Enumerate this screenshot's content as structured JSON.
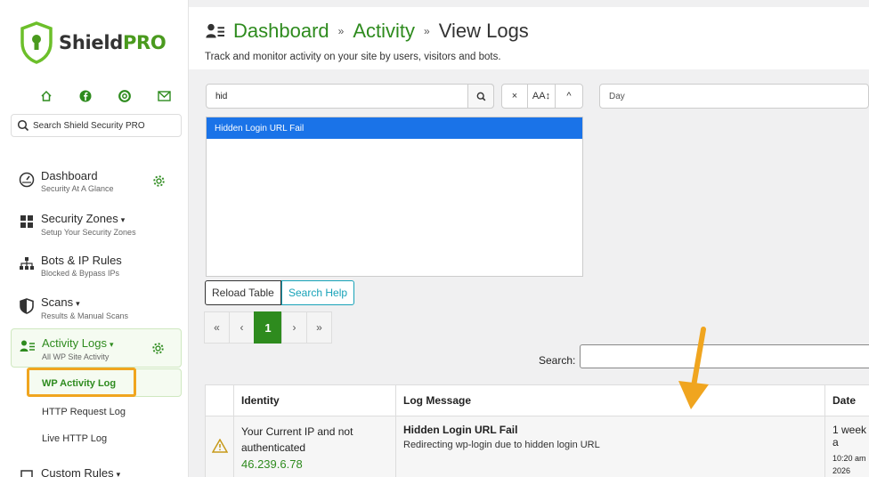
{
  "brand": {
    "name_main": "Shield",
    "name_accent": "PRO",
    "accent_color": "#2e8b1e",
    "highlight_color": "#f0a51f"
  },
  "sidebar": {
    "quick_icons": [
      "home-icon",
      "facebook-icon",
      "lifebuoy-icon",
      "mail-icon"
    ],
    "search_placeholder": "Search Shield Security PRO",
    "items": [
      {
        "title": "Dashboard",
        "sub": "Security At A Glance",
        "icon": "gauge-icon"
      },
      {
        "title": "Security Zones",
        "sub": "Setup Your Security Zones",
        "icon": "grid-icon",
        "caret": "▾"
      },
      {
        "title": "Bots & IP Rules",
        "sub": "Blocked & Bypass IPs",
        "icon": "network-icon"
      },
      {
        "title": "Scans",
        "sub": "Results & Manual Scans",
        "icon": "shield-icon",
        "caret": "▾"
      },
      {
        "title": "Activity Logs",
        "sub": "All WP Site Activity",
        "icon": "user-list-icon",
        "caret": "▾"
      },
      {
        "title": "Custom Rules",
        "icon": "rules-icon",
        "caret": "▾"
      }
    ],
    "subitems": [
      "WP Activity Log",
      "HTTP Request Log",
      "Live HTTP Log"
    ]
  },
  "header": {
    "breadcrumb": [
      "Dashboard",
      "Activity",
      "View Logs"
    ],
    "separator": "»",
    "subtitle": "Track and monitor activity on your site by users, visitors and bots."
  },
  "searchbuilder": {
    "query": "hid",
    "clear_label": "×",
    "case_label": "AA↕",
    "collapse_label": "^",
    "suggestion": "Hidden Login URL Fail",
    "date_placeholder": "Day"
  },
  "buttons": {
    "reload": "Reload Table",
    "help": "Search Help"
  },
  "pager": {
    "first": "«",
    "prev": "‹",
    "current": "1",
    "next": "›",
    "last": "»"
  },
  "table": {
    "search_label": "Search:",
    "headers": [
      "Identity",
      "Log Message",
      "Date"
    ],
    "row": {
      "identity": "Your Current IP and not authenticated",
      "ip": "46.239.6.78",
      "message_title": "Hidden Login URL Fail",
      "message_sub": "Redirecting wp-login due to hidden login URL",
      "date_main": "1 week a",
      "date_time": "10:20 am",
      "date_year": "2026"
    }
  }
}
